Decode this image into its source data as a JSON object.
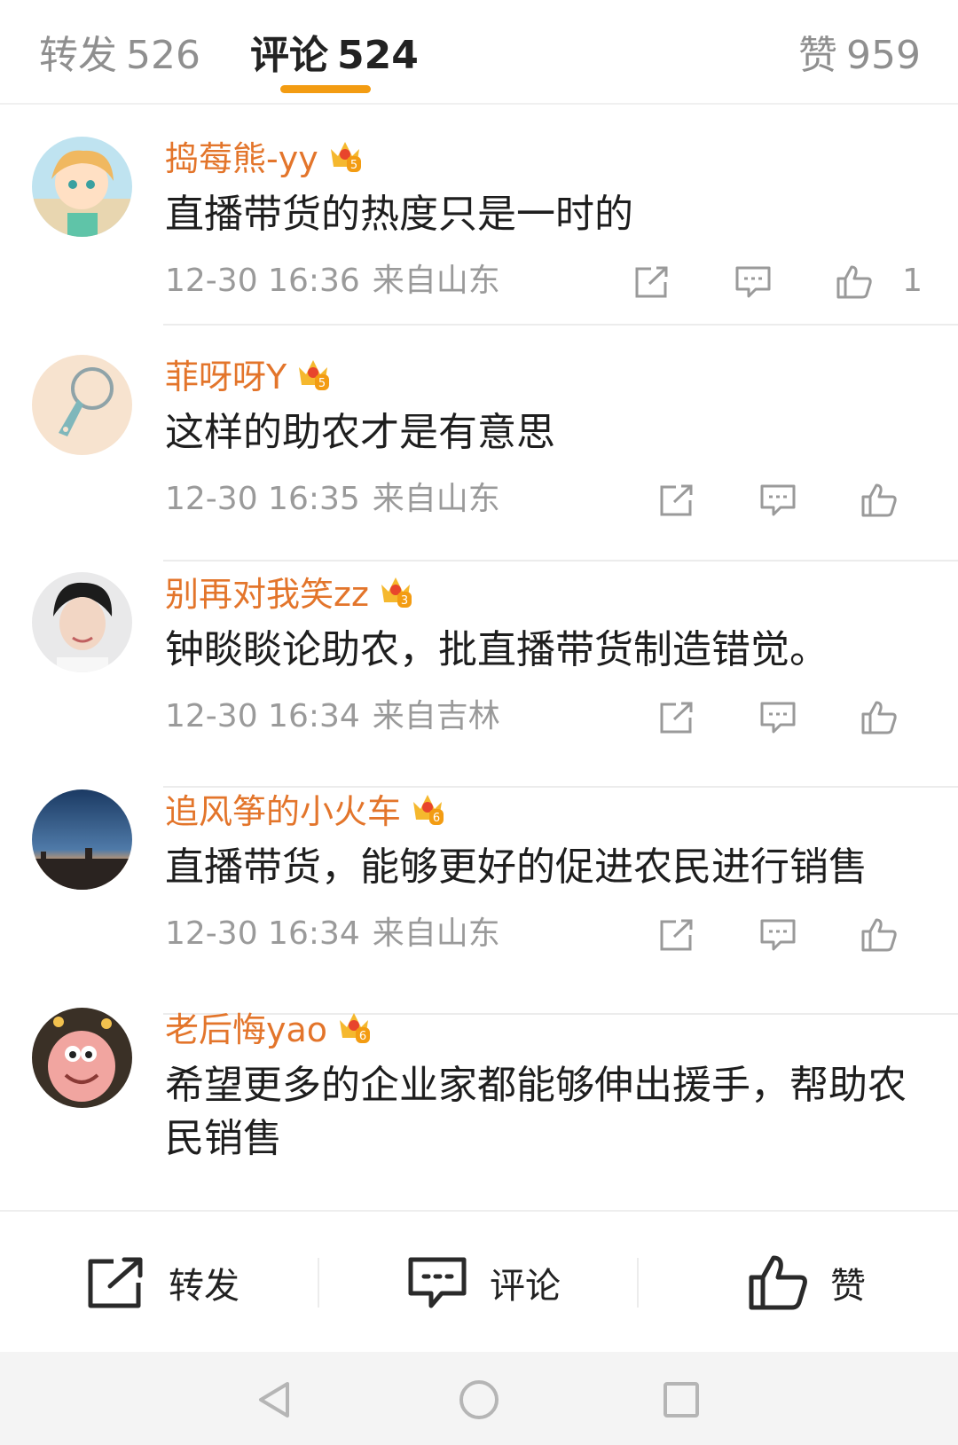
{
  "tabs": {
    "repost": {
      "label": "转发",
      "count": "526"
    },
    "comment": {
      "label": "评论",
      "count": "524"
    },
    "like": {
      "label": "赞",
      "count": "959"
    }
  },
  "comments": [
    {
      "username": "捣莓熊-yy",
      "level": "5",
      "text": "直播带货的热度只是一时的",
      "time": "12-30 16:36",
      "location": "来自山东",
      "likes": "1"
    },
    {
      "username": "菲呀呀Y",
      "level": "5",
      "text": "这样的助农才是有意思",
      "time": "12-30 16:35",
      "location": "来自山东",
      "likes": ""
    },
    {
      "username": "别再对我笑zz",
      "level": "3",
      "text": "钟睒睒论助农，批直播带货制造错觉。",
      "time": "12-30 16:34",
      "location": "来自吉林",
      "likes": ""
    },
    {
      "username": "追风筝的小火车",
      "level": "6",
      "text": "直播带货，能够更好的促进农民进行销售",
      "time": "12-30 16:34",
      "location": "来自山东",
      "likes": ""
    },
    {
      "username": "老后悔yao",
      "level": "6",
      "text": "希望更多的企业家都能够伸出援手，帮助农民销售",
      "time": "",
      "location": "",
      "likes": ""
    }
  ],
  "bottom_bar": {
    "repost": "转发",
    "comment": "评论",
    "like": "赞"
  },
  "colors": {
    "accent": "#f39c12",
    "username": "#e3752b",
    "meta": "#9a9a9a"
  },
  "icons": [
    "share-icon",
    "comment-icon",
    "thumbs-up-icon",
    "crown-badge-icon",
    "back-icon",
    "home-icon",
    "recent-apps-icon"
  ]
}
